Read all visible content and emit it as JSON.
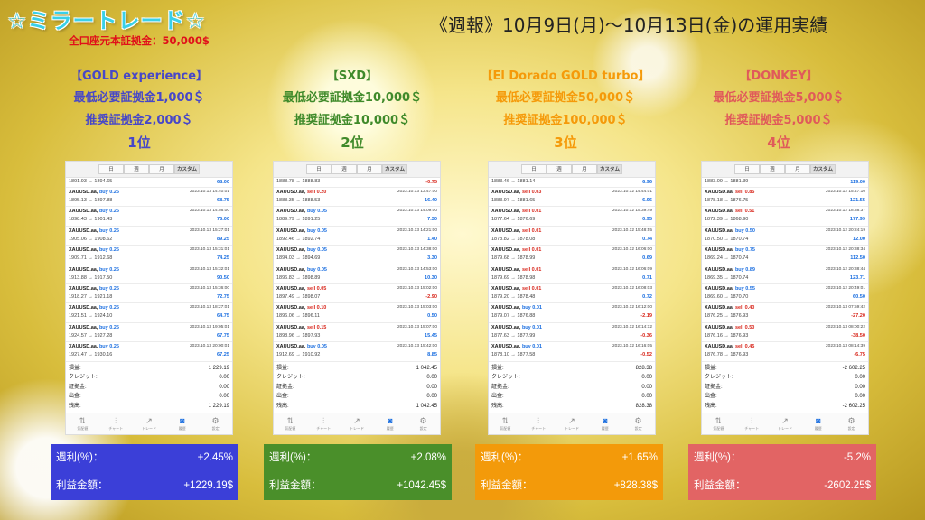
{
  "header": {
    "brand": "☆ミラートレード☆",
    "deposit": "全口座元本証拠金：50,000$",
    "report_title": "《週報》10月9日(月)～10月13日(金)の運用実績"
  },
  "tabs": [
    "日",
    "週",
    "月",
    "カスタム"
  ],
  "nav": [
    {
      "label": "気配値",
      "icon": "quotes-icon"
    },
    {
      "label": "チャート",
      "icon": "chart-icon"
    },
    {
      "label": "トレード",
      "icon": "trade-icon"
    },
    {
      "label": "履歴",
      "icon": "history-icon"
    },
    {
      "label": "設定",
      "icon": "gear-icon"
    }
  ],
  "summary_labels": [
    "損益:",
    "クレジット:",
    "証拠金:",
    "出金:",
    "残高:"
  ],
  "result_labels": {
    "weekly": "週利(%)：",
    "profit": "利益金額："
  },
  "colors": {
    "blue": "#3b3fd8",
    "green": "#4a8f2a",
    "orange": "#f39a0a",
    "red": "#e26464",
    "blue_text": "#4747c8",
    "green_text": "#3f8a2a",
    "orange_text": "#f59a0a",
    "red_text": "#e05a5a"
  },
  "columns": [
    {
      "name": "【GOLD experience】",
      "min": "最低必要証拠金1,000＄",
      "rec": "推奨証拠金2,000＄",
      "rank": "1位",
      "first": {
        "prices": "1891.93 → 1894.65",
        "profit": "68.00",
        "sign": "pos"
      },
      "deals": [
        {
          "sym": "XAUUSD.aa,",
          "dir": "buy",
          "lot": "0.25",
          "prices": "1895.13 → 1897.88",
          "dt": "2023.10.13 14:40:01",
          "profit": "68.75",
          "sign": "pos"
        },
        {
          "sym": "XAUUSD.aa,",
          "dir": "buy",
          "lot": "0.25",
          "prices": "1898.43 → 1901.43",
          "dt": "2023.10.13 14:56:00",
          "profit": "75.00",
          "sign": "pos"
        },
        {
          "sym": "XAUUSD.aa,",
          "dir": "buy",
          "lot": "0.25",
          "prices": "1905.06 → 1908.62",
          "dt": "2023.10.13 15:27:01",
          "profit": "89.25",
          "sign": "pos"
        },
        {
          "sym": "XAUUSD.aa,",
          "dir": "buy",
          "lot": "0.25",
          "prices": "1909.71 → 1912.68",
          "dt": "2023.10.13 15:31:01",
          "profit": "74.25",
          "sign": "pos"
        },
        {
          "sym": "XAUUSD.aa,",
          "dir": "buy",
          "lot": "0.25",
          "prices": "1913.88 → 1917.50",
          "dt": "2023.10.13 15:32:01",
          "profit": "90.50",
          "sign": "pos"
        },
        {
          "sym": "XAUUSD.aa,",
          "dir": "buy",
          "lot": "0.25",
          "prices": "1918.27 → 1921.18",
          "dt": "2023.10.13 15:36:00",
          "profit": "72.75",
          "sign": "pos"
        },
        {
          "sym": "XAUUSD.aa,",
          "dir": "buy",
          "lot": "0.25",
          "prices": "1921.51 → 1924.10",
          "dt": "2023.10.13 18:27:01",
          "profit": "64.75",
          "sign": "pos"
        },
        {
          "sym": "XAUUSD.aa,",
          "dir": "buy",
          "lot": "0.25",
          "prices": "1924.57 → 1927.28",
          "dt": "2023.10.13 19:05:01",
          "profit": "67.75",
          "sign": "pos"
        },
        {
          "sym": "XAUUSD.aa,",
          "dir": "buy",
          "lot": "0.25",
          "prices": "1927.47 → 1930.16",
          "dt": "2023.10.13 20:00:01",
          "profit": "67.25",
          "sign": "pos"
        }
      ],
      "summary": [
        "1 229.19",
        "0.00",
        "0.00",
        "0.00",
        "1 229.19"
      ],
      "weekly": "+2.45%",
      "profit": "+1229.19$"
    },
    {
      "name": "【SXD】",
      "min": "最低必要証拠金10,000＄",
      "rec": "推奨証拠金10,000＄",
      "rank": "2位",
      "first": {
        "prices": "1888.78 → 1888.83",
        "profit": "-0.75",
        "sign": "neg"
      },
      "deals": [
        {
          "sym": "XAUUSD.aa,",
          "dir": "sell",
          "lot": "0.20",
          "prices": "1888.35 → 1888.53",
          "dt": "2023.10.13 13:47:00",
          "profit": "16.40",
          "sign": "pos"
        },
        {
          "sym": "XAUUSD.aa,",
          "dir": "buy",
          "lot": "0.05",
          "prices": "1889.79 → 1891.25",
          "dt": "2023.10.13 14:09:00",
          "profit": "7.30",
          "sign": "pos"
        },
        {
          "sym": "XAUUSD.aa,",
          "dir": "buy",
          "lot": "0.05",
          "prices": "1892.46 → 1892.74",
          "dt": "2023.10.13 14:21:00",
          "profit": "1.40",
          "sign": "pos"
        },
        {
          "sym": "XAUUSD.aa,",
          "dir": "buy",
          "lot": "0.05",
          "prices": "1894.03 → 1894.69",
          "dt": "2023.10.13 14:38:00",
          "profit": "3.30",
          "sign": "pos"
        },
        {
          "sym": "XAUUSD.aa,",
          "dir": "buy",
          "lot": "0.05",
          "prices": "1896.83 → 1898.89",
          "dt": "2023.10.13 14:53:00",
          "profit": "10.30",
          "sign": "pos"
        },
        {
          "sym": "XAUUSD.aa,",
          "dir": "sell",
          "lot": "0.05",
          "prices": "1897.49 → 1898.07",
          "dt": "2023.10.13 15:02:00",
          "profit": "-2.90",
          "sign": "neg"
        },
        {
          "sym": "XAUUSD.aa,",
          "dir": "sell",
          "lot": "0.10",
          "prices": "1896.06 → 1896.11",
          "dt": "2023.10.13 15:03:00",
          "profit": "0.50",
          "sign": "pos"
        },
        {
          "sym": "XAUUSD.aa,",
          "dir": "sell",
          "lot": "0.15",
          "prices": "1898.96 → 1897.93",
          "dt": "2023.10.13 15:07:00",
          "profit": "15.45",
          "sign": "pos"
        },
        {
          "sym": "XAUUSD.aa,",
          "dir": "buy",
          "lot": "0.05",
          "prices": "1912.69 → 1910.92",
          "dt": "2023.10.13 15:42:00",
          "profit": "8.85",
          "sign": "pos"
        }
      ],
      "summary": [
        "1 042.45",
        "0.00",
        "0.00",
        "0.00",
        "1 042.45"
      ],
      "weekly": "+2.08%",
      "profit": "+1042.45$"
    },
    {
      "name": "【El Dorado GOLD turbo】",
      "min": "最低必要証拠金50,000＄",
      "rec": "推奨証拠金100,000＄",
      "rank": "3位",
      "first": {
        "prices": "1883.46 → 1881.14",
        "profit": "6.96",
        "sign": "pos"
      },
      "deals": [
        {
          "sym": "XAUUSD.aa,",
          "dir": "sell",
          "lot": "0.03",
          "prices": "1883.97 → 1881.65",
          "dt": "2023.10.12 14:44:01",
          "profit": "6.96",
          "sign": "pos"
        },
        {
          "sym": "XAUUSD.aa,",
          "dir": "sell",
          "lot": "0.01",
          "prices": "1877.64 → 1876.69",
          "dt": "2023.10.12 15:39:49",
          "profit": "0.95",
          "sign": "pos"
        },
        {
          "sym": "XAUUSD.aa,",
          "dir": "sell",
          "lot": "0.01",
          "prices": "1878.82 → 1878.08",
          "dt": "2023.10.12 15:48:55",
          "profit": "0.74",
          "sign": "pos"
        },
        {
          "sym": "XAUUSD.aa,",
          "dir": "sell",
          "lot": "0.01",
          "prices": "1879.68 → 1878.99",
          "dt": "2023.10.12 16:06:00",
          "profit": "0.69",
          "sign": "pos"
        },
        {
          "sym": "XAUUSD.aa,",
          "dir": "sell",
          "lot": "0.01",
          "prices": "1879.69 → 1878.98",
          "dt": "2023.10.12 16:06:09",
          "profit": "0.71",
          "sign": "pos"
        },
        {
          "sym": "XAUUSD.aa,",
          "dir": "sell",
          "lot": "0.01",
          "prices": "1879.20 → 1878.48",
          "dt": "2023.10.12 16:08:03",
          "profit": "0.72",
          "sign": "pos"
        },
        {
          "sym": "XAUUSD.aa,",
          "dir": "buy",
          "lot": "0.01",
          "prices": "1879.07 → 1876.88",
          "dt": "2023.10.12 16:12:00",
          "profit": "-2.19",
          "sign": "neg"
        },
        {
          "sym": "XAUUSD.aa,",
          "dir": "buy",
          "lot": "0.01",
          "prices": "1877.63 → 1877.99",
          "dt": "2023.10.12 16:14:12",
          "profit": "-0.36",
          "sign": "neg"
        },
        {
          "sym": "XAUUSD.aa,",
          "dir": "buy",
          "lot": "0.01",
          "prices": "1878.10 → 1877.58",
          "dt": "2023.10.12 16:16:05",
          "profit": "-0.52",
          "sign": "neg"
        }
      ],
      "summary": [
        "828.38",
        "0.00",
        "0.00",
        "0.00",
        "828.38"
      ],
      "weekly": "+1.65%",
      "profit": "+828.38$"
    },
    {
      "name": "【DONKEY】",
      "min": "最低必要証拠金5,000＄",
      "rec": "推奨証拠金5,000＄",
      "rank": "4位",
      "first": {
        "prices": "1883.09 → 1881.39",
        "profit": "119.00",
        "sign": "pos"
      },
      "deals": [
        {
          "sym": "XAUUSD.aa,",
          "dir": "sell",
          "lot": "0.85",
          "prices": "1878.18 → 1876.75",
          "dt": "2023.10.12 15:47:10",
          "profit": "121.55",
          "sign": "pos"
        },
        {
          "sym": "XAUUSD.aa,",
          "dir": "sell",
          "lot": "0.51",
          "prices": "1872.39 → 1868.90",
          "dt": "2023.10.12 18:38:37",
          "profit": "177.99",
          "sign": "pos"
        },
        {
          "sym": "XAUUSD.aa,",
          "dir": "buy",
          "lot": "0.50",
          "prices": "1870.50 → 1870.74",
          "dt": "2023.10.12 20:24:19",
          "profit": "12.00",
          "sign": "pos"
        },
        {
          "sym": "XAUUSD.aa,",
          "dir": "buy",
          "lot": "0.75",
          "prices": "1869.24 → 1870.74",
          "dt": "2023.10.12 20:38:34",
          "profit": "112.50",
          "sign": "pos"
        },
        {
          "sym": "XAUUSD.aa,",
          "dir": "buy",
          "lot": "0.89",
          "prices": "1869.35 → 1870.74",
          "dt": "2023.10.12 20:38:44",
          "profit": "123.71",
          "sign": "pos"
        },
        {
          "sym": "XAUUSD.aa,",
          "dir": "buy",
          "lot": "0.55",
          "prices": "1869.60 → 1870.70",
          "dt": "2023.10.12 20:49:01",
          "profit": "60.50",
          "sign": "pos"
        },
        {
          "sym": "XAUUSD.aa,",
          "dir": "sell",
          "lot": "0.40",
          "prices": "1876.25 → 1876.93",
          "dt": "2023.10.13 07:59:42",
          "profit": "-27.20",
          "sign": "neg"
        },
        {
          "sym": "XAUUSD.aa,",
          "dir": "sell",
          "lot": "0.50",
          "prices": "1876.16 → 1876.93",
          "dt": "2023.10.13 08:00:22",
          "profit": "-38.50",
          "sign": "neg"
        },
        {
          "sym": "XAUUSD.aa,",
          "dir": "sell",
          "lot": "0.45",
          "prices": "1876.78 → 1876.93",
          "dt": "2023.10.13 08:14:39",
          "profit": "-6.75",
          "sign": "neg"
        }
      ],
      "summary": [
        "-2 602.25",
        "0.00",
        "0.00",
        "0.00",
        "-2 602.25"
      ],
      "weekly": "-5.2%",
      "profit": "-2602.25$"
    }
  ]
}
